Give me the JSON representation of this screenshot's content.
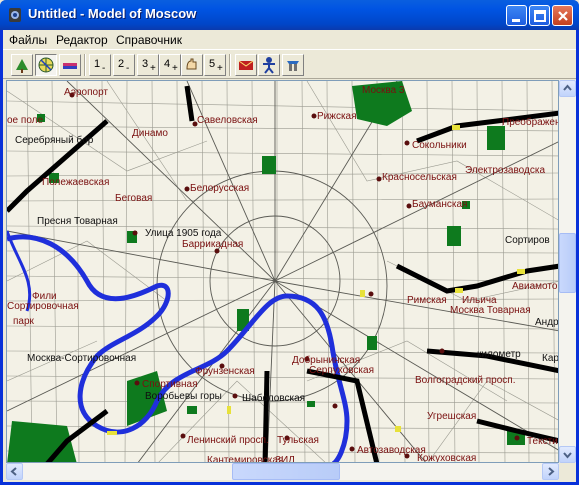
{
  "window": {
    "title": "Untitled - Model of Moscow",
    "controls": [
      "minimize",
      "maximize",
      "close"
    ]
  },
  "menu": {
    "items": [
      {
        "label": "Файлы",
        "underline": "Ф"
      },
      {
        "label": "Редактор",
        "underline": "Р"
      },
      {
        "label": "Справочник",
        "underline": "С"
      }
    ]
  },
  "toolbar": {
    "view_tools": [
      {
        "icon": "map-tree-icon",
        "pressed": false
      },
      {
        "icon": "globe-icon",
        "pressed": true
      },
      {
        "icon": "vehicle-icon",
        "pressed": false
      }
    ],
    "zoom_levels": [
      {
        "n": "1",
        "s": "-"
      },
      {
        "n": "2",
        "s": "-"
      },
      {
        "n": "3",
        "s": "+"
      },
      {
        "n": "4",
        "s": "+"
      },
      {
        "n": "",
        "s": ""
      },
      {
        "n": "5",
        "s": "+"
      }
    ],
    "action_tools": [
      {
        "icon": "mail-icon"
      },
      {
        "icon": "person-icon"
      },
      {
        "icon": "tools-icon"
      }
    ]
  },
  "map": {
    "labels": [
      "Аэропорт",
      "Савеловская",
      "Рижская",
      "Москва 3",
      "Преображен",
      "Динамо",
      "Серебряный бор",
      "Сокольники",
      "Полежаевская",
      "Белорусская",
      "Красносельская",
      "Электрозаводска",
      "Беговая",
      "Бауманская",
      "Пресня Товарная",
      "Улица 1905 года",
      "Баррикадная",
      "Сортиров",
      "Римская",
      "Ильича",
      "Авиамотори",
      "Москва Товарная",
      "Андро",
      "Сортировочная",
      "парк",
      "Москва-Сортировочная",
      "Добрынинская",
      "Серпуховская",
      "километр",
      "Кар",
      "Спортивная",
      "Фрунзенская",
      "Волгоградский просп.",
      "Воробьевы горы",
      "Шаболовская",
      "Угрешская",
      "Ленинский просп.",
      "Тульская",
      "Текстильщ",
      "Автозаводская",
      "Кантемировская",
      "ЗИЛ",
      "Кожуховская",
      "ое поле",
      "Фили"
    ]
  },
  "colors": {
    "accent": "#0054E3",
    "map_bg": "#F3F1E6",
    "park": "#0E7A1E",
    "river": "#1F2FDB",
    "label": "#7A1010",
    "road": "#000000",
    "station": "#E7E13A"
  }
}
